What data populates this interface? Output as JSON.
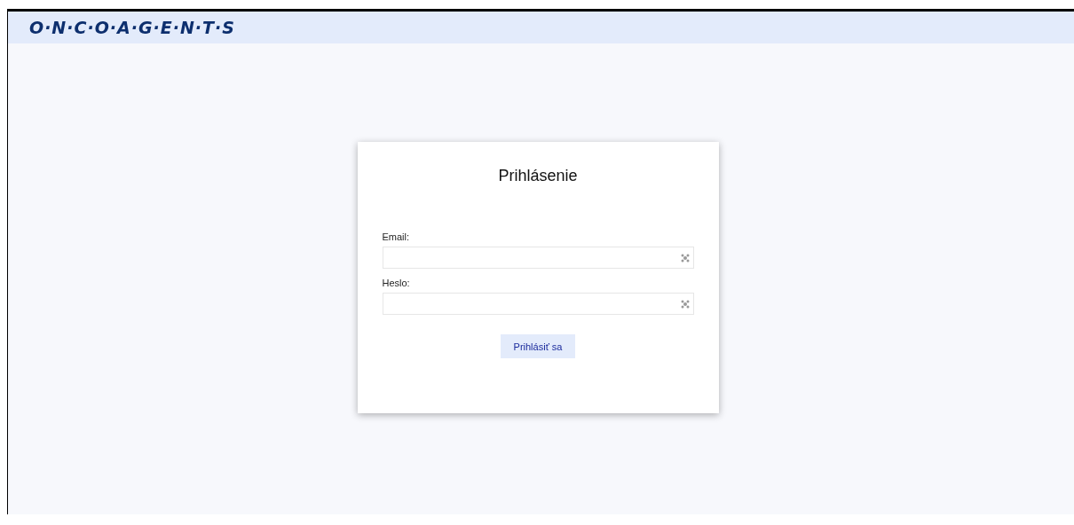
{
  "header": {
    "logo": "O·N·C·O·A·G·E·N·T·S"
  },
  "login": {
    "title": "Prihlásenie",
    "fields": [
      {
        "label": "Email:"
      },
      {
        "label": "Heslo:"
      }
    ],
    "submit": "Prihlásiť sa"
  }
}
